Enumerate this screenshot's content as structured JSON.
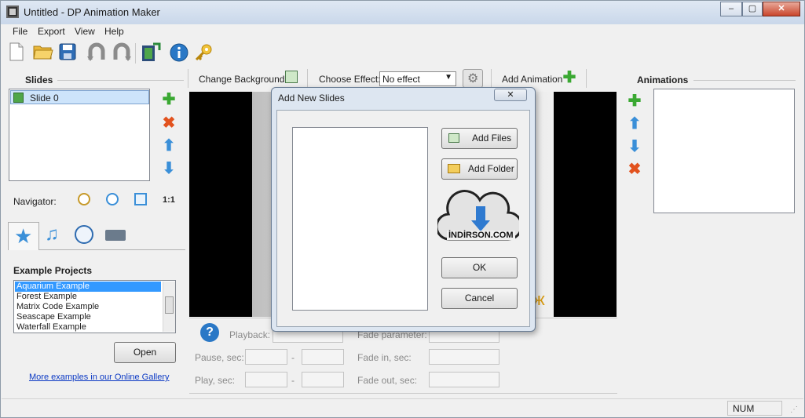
{
  "window": {
    "title": "Untitled - DP Animation Maker",
    "controls": [
      "–",
      "▢",
      "✕"
    ]
  },
  "menu": [
    "File",
    "Export",
    "View",
    "Help"
  ],
  "toolbar": {
    "icons": [
      "new-file-icon",
      "open-folder-icon",
      "save-icon",
      "undo-icon",
      "redo-icon",
      "export-video-icon",
      "info-icon",
      "key-icon"
    ]
  },
  "slides_panel": {
    "header": "Slides",
    "items": [
      {
        "label": "Slide 0",
        "selected": true
      }
    ]
  },
  "navigator": {
    "label": "Navigator:",
    "zoom_1to1": "1:1"
  },
  "examples": {
    "header": "Example Projects",
    "items": [
      "Aquarium Example",
      "Forest Example",
      "Matrix Code Example",
      "Seascape Example",
      "Waterfall Example"
    ],
    "selected": "Aquarium Example",
    "open_label": "Open",
    "gallery_link": "More examples in our Online Gallery"
  },
  "top_bar": {
    "change_background": "Change Background",
    "choose_effect_label": "Choose Effect:",
    "effect_value": "No effect",
    "add_animation": "Add Animation"
  },
  "animations_panel": {
    "header": "Animations"
  },
  "controls": {
    "playback": "Playback:",
    "pause": "Pause, sec:",
    "play": "Play, sec:",
    "fade_parameter": "Fade parameter:",
    "fade_in": "Fade in, sec:",
    "fade_out": "Fade out, sec:",
    "dash": "-"
  },
  "status": {
    "num": "NUM"
  },
  "dialog": {
    "title": "Add New Slides",
    "close": "✕",
    "add_files": "Add Files",
    "add_folder": "Add Folder",
    "ok": "OK",
    "cancel": "Cancel",
    "watermark": "İNDİRSON.COM"
  }
}
